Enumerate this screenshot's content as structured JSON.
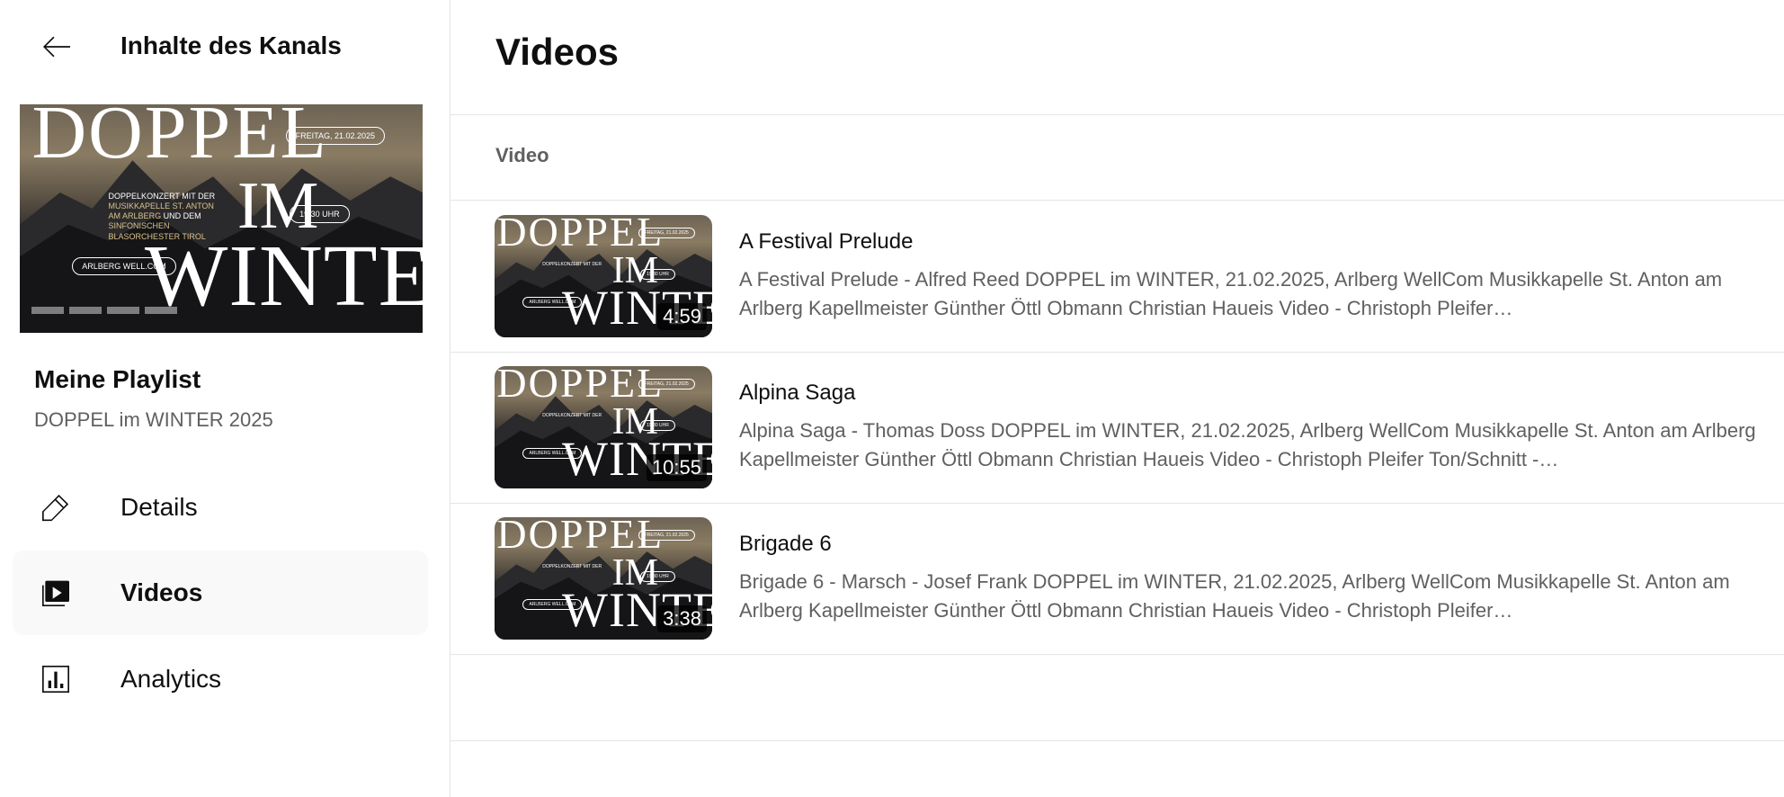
{
  "sidebar": {
    "header_title": "Inhalte des Kanals",
    "playlist": {
      "title": "Meine Playlist",
      "subtitle": "DOPPEL im WINTER 2025"
    },
    "nav": [
      {
        "label": "Details",
        "icon": "pencil-icon",
        "active": false
      },
      {
        "label": "Videos",
        "icon": "video-library-icon",
        "active": true
      },
      {
        "label": "Analytics",
        "icon": "analytics-icon",
        "active": false
      }
    ]
  },
  "thumbnail": {
    "line1": "DOPPEL",
    "line2": "IM",
    "line3": "WINTER",
    "date": "FREITAG, 21.02.2025",
    "time": "19:30 UHR",
    "website": "ARLBERG WELL.COM",
    "body_white_1": "DOPPELKONZERT MIT DER",
    "body_gold_1": "MUSIKKAPELLE ST. ANTON",
    "body_gold_2": "AM ARLBERG",
    "body_white_2": "UND DEM",
    "body_gold_3": "SINFONISCHEN",
    "body_gold_4": "BLASORCHESTER TIROL"
  },
  "main": {
    "title": "Videos",
    "column_header": "Video",
    "videos": [
      {
        "title": "A Festival Prelude",
        "duration": "4:59",
        "description": "A Festival Prelude - Alfred Reed DOPPEL im WINTER, 21.02.2025, Arlberg WellCom Musikkapelle St. Anton am Arlberg Kapellmeister Günther Öttl Obmann Christian Haueis Video - Christoph Pleifer…"
      },
      {
        "title": "Alpina Saga",
        "duration": "10:55",
        "description": "Alpina Saga - Thomas Doss DOPPEL im WINTER, 21.02.2025, Arlberg WellCom Musikkapelle St. Anton am Arlberg Kapellmeister Günther Öttl Obmann Christian Haueis Video - Christoph Pleifer Ton/Schnitt -…"
      },
      {
        "title": "Brigade 6",
        "duration": "3:38",
        "description": "Brigade 6 - Marsch - Josef Frank DOPPEL im WINTER, 21.02.2025, Arlberg WellCom Musikkapelle St. Anton am Arlberg Kapellmeister Günther Öttl Obmann Christian Haueis Video - Christoph Pleifer…"
      }
    ]
  }
}
